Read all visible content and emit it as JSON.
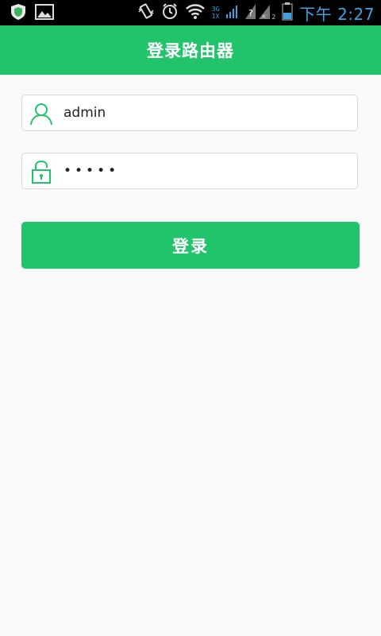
{
  "status_bar": {
    "network_labels": [
      "3G",
      "1X"
    ],
    "sim_slot": "2",
    "time": "下午 2:27",
    "accent_color": "#3aa3e0"
  },
  "header": {
    "title": "登录路由器",
    "background_color": "#22c46b"
  },
  "form": {
    "username": {
      "value": "admin",
      "icon": "user-icon"
    },
    "password": {
      "value": "•••••",
      "icon": "lock-icon"
    },
    "login_label": "登录"
  }
}
